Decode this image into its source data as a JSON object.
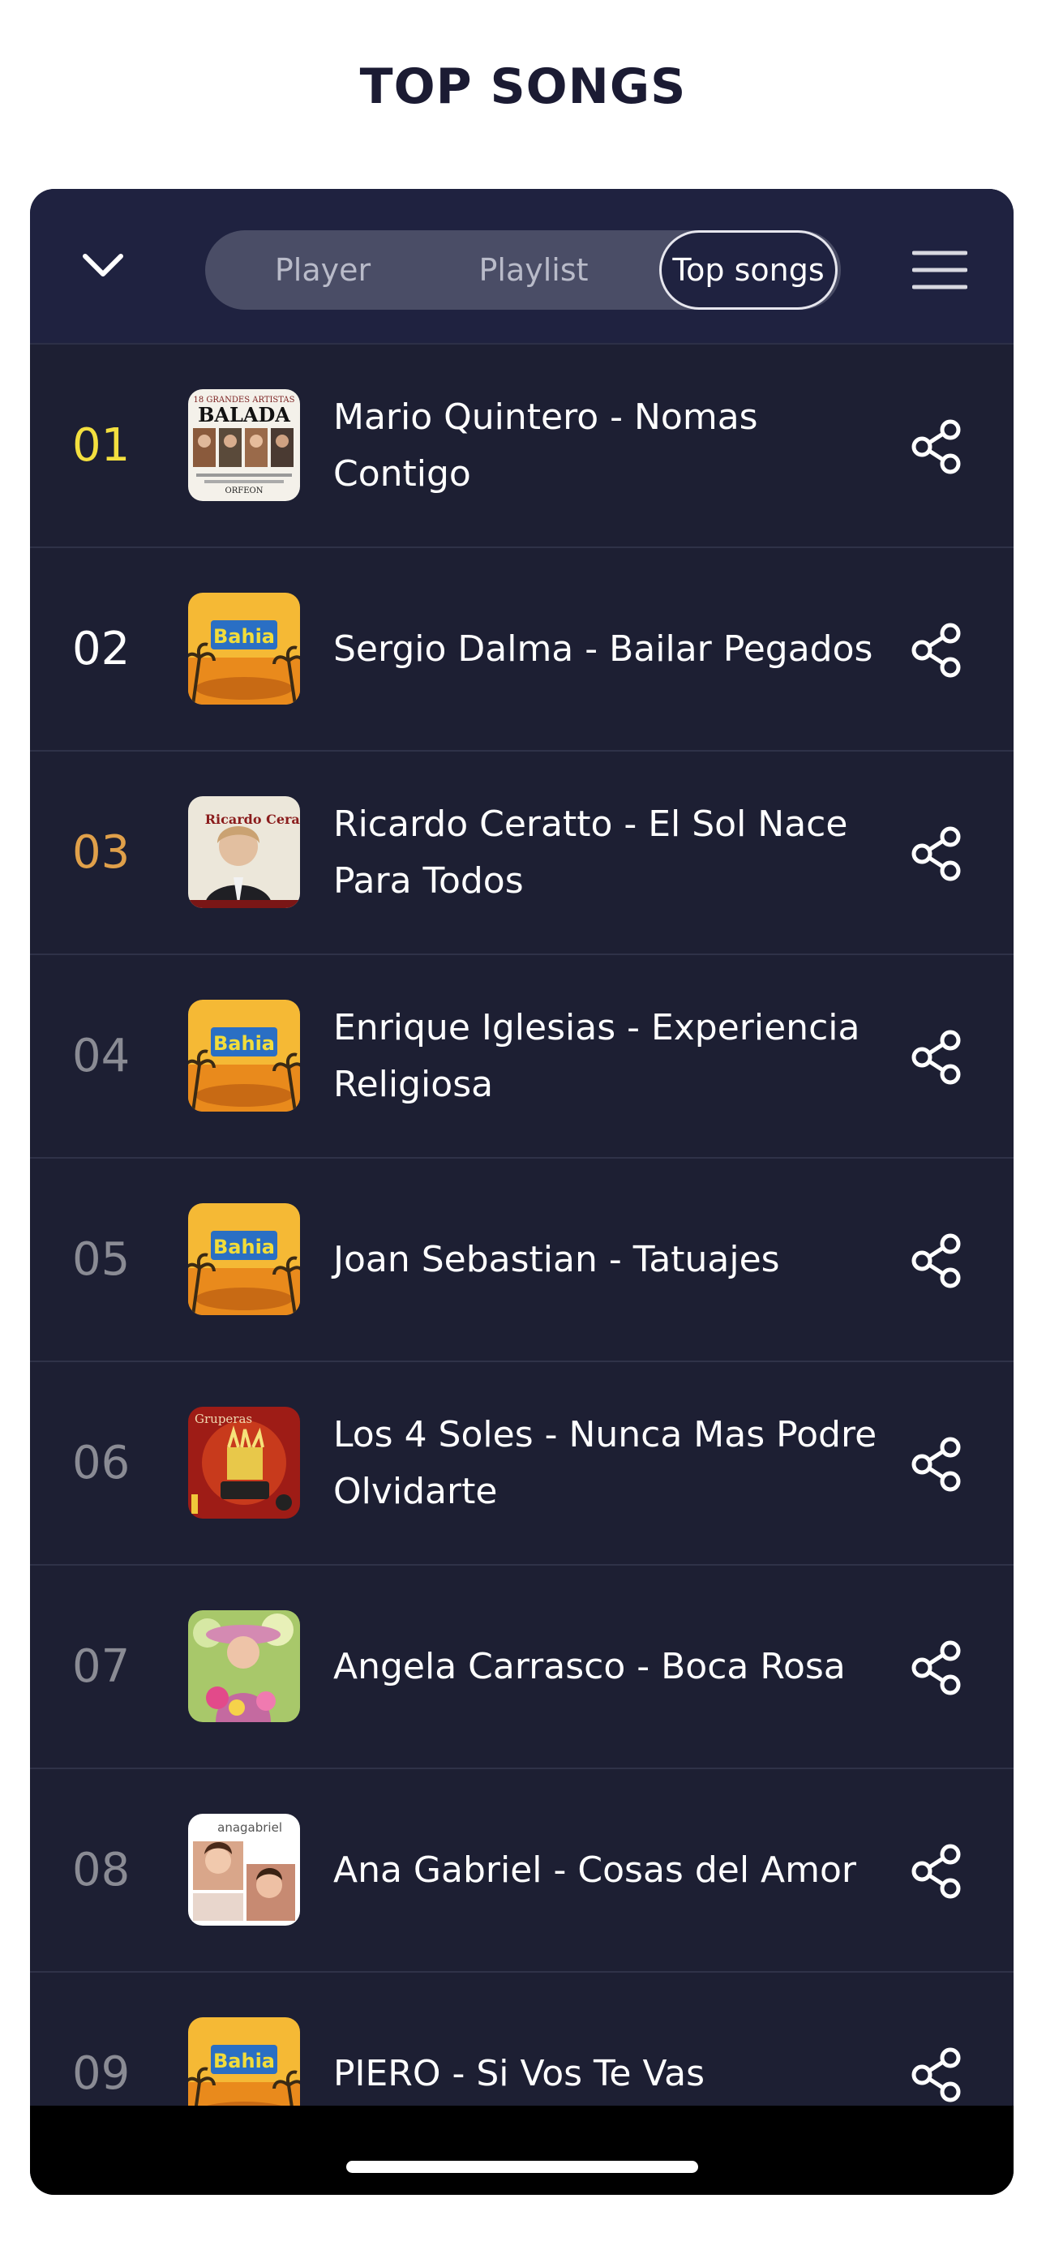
{
  "page": {
    "title": "TOP SONGS"
  },
  "header": {
    "tabs": [
      {
        "label": "Player",
        "active": false
      },
      {
        "label": "Playlist",
        "active": false
      },
      {
        "label": "Top songs",
        "active": true
      }
    ]
  },
  "icons": {
    "collapse": "chevron-down-icon",
    "menu": "hamburger-menu-icon",
    "share": "share-icon"
  },
  "colors": {
    "card_background": "#1d1f33",
    "rank_gold": "#f3df3f",
    "rank_silver": "#ffffff",
    "rank_bronze": "#e0a04a",
    "rank_default": "#8a8b94"
  },
  "songs": [
    {
      "rank": "01",
      "title": "Mario Quintero - Nomas Contigo",
      "art": "balada-cover"
    },
    {
      "rank": "02",
      "title": "Sergio Dalma - Bailar Pegados",
      "art": "bahia-cover"
    },
    {
      "rank": "03",
      "title": "Ricardo Ceratto - El Sol Nace Para Todos",
      "art": "ricardo-ceratto-cover"
    },
    {
      "rank": "04",
      "title": "Enrique Iglesias - Experiencia Religiosa",
      "art": "bahia-cover"
    },
    {
      "rank": "05",
      "title": "Joan Sebastian - Tatuajes",
      "art": "bahia-cover"
    },
    {
      "rank": "06",
      "title": "Los 4 Soles - Nunca Mas Podre Olvidarte",
      "art": "gruperas-cover"
    },
    {
      "rank": "07",
      "title": "Angela Carrasco - Boca Rosa",
      "art": "floral-portrait-cover"
    },
    {
      "rank": "08",
      "title": "Ana Gabriel - Cosas del Amor",
      "art": "ana-gabriel-cover"
    },
    {
      "rank": "09",
      "title": "PIERO - Si Vos Te Vas",
      "art": "bahia-cover"
    }
  ],
  "cover_text": {
    "balada": [
      "18 GRANDES ARTISTAS",
      "BALADA",
      "ORFEON"
    ],
    "bahia": "Bahia",
    "ricardo": "Ricardo Ceratto",
    "gruperas": "Gruperas",
    "ana": "anagabriel"
  }
}
